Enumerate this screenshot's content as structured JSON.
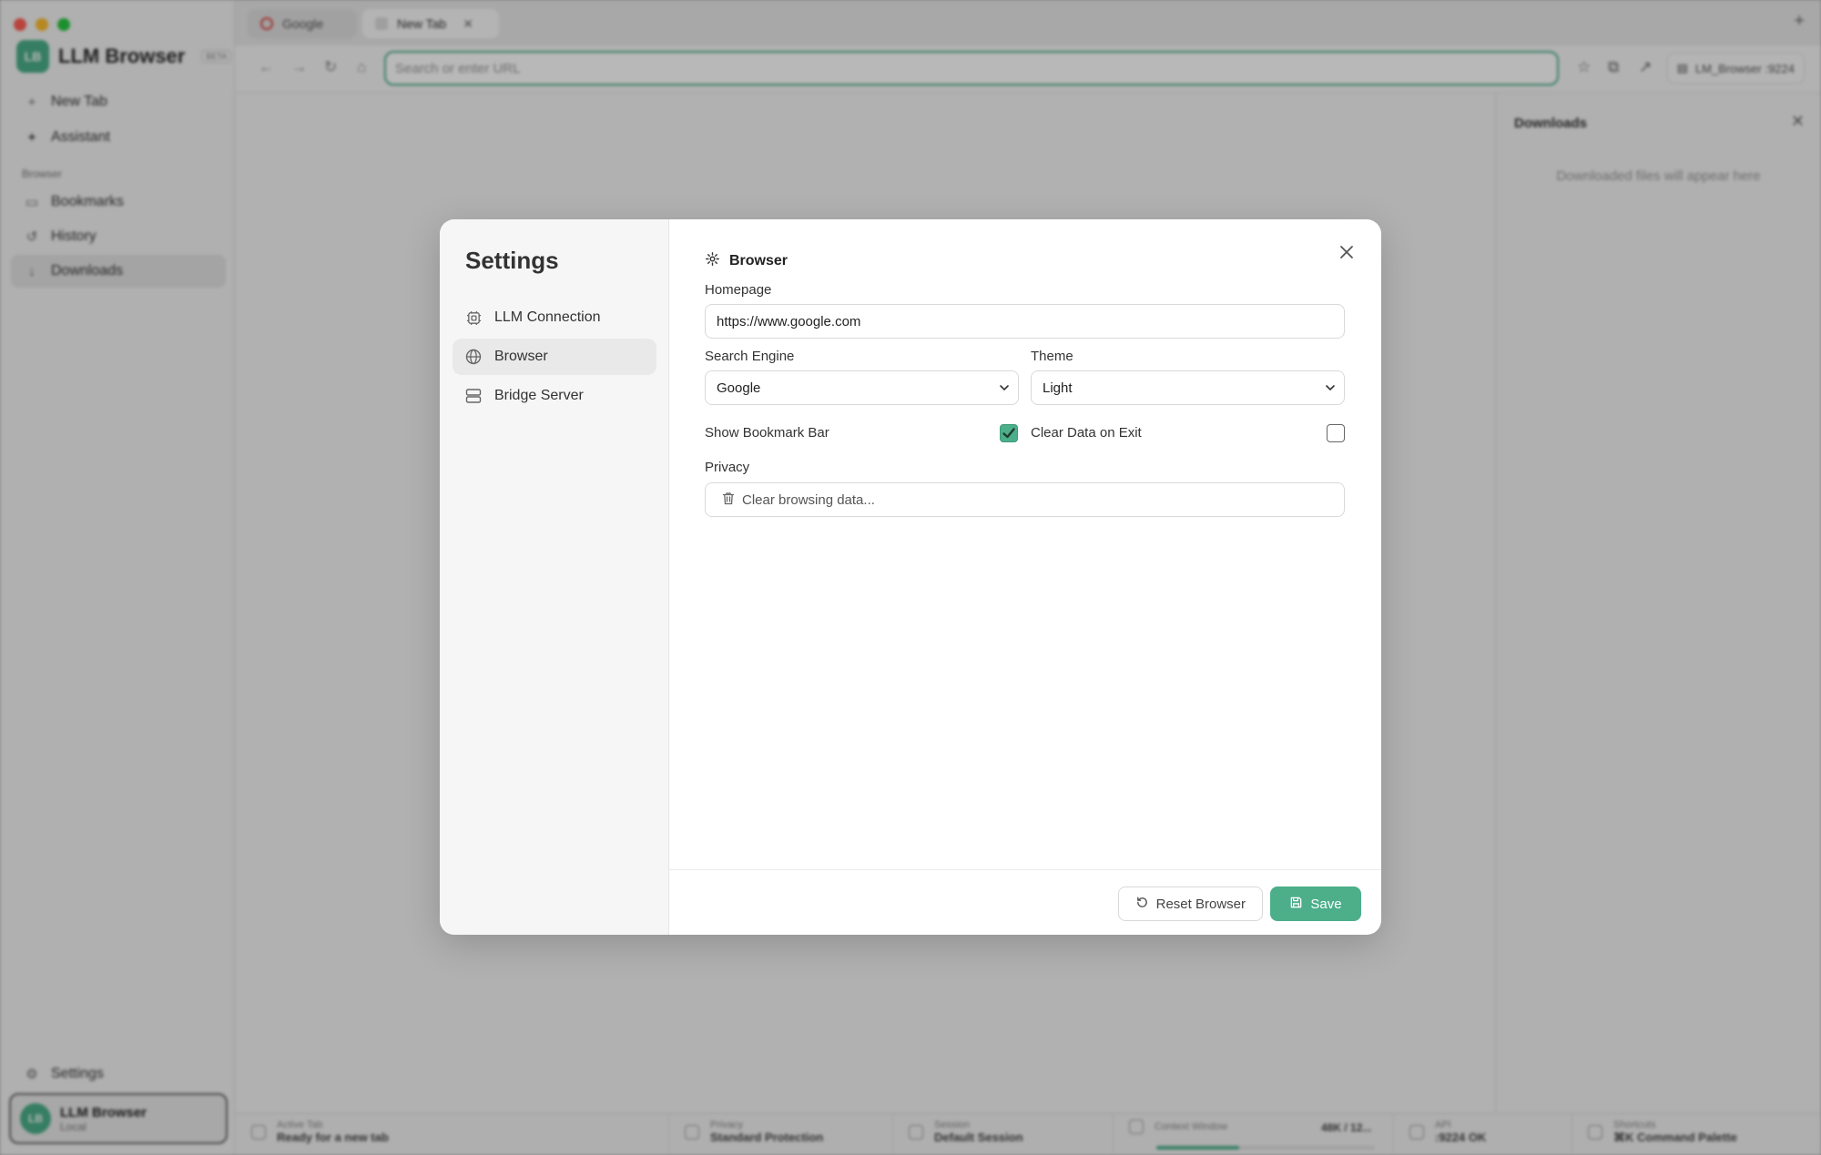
{
  "app": {
    "brand_name": "LLM Browser",
    "brand_logo_text": "LB",
    "beta_label": "BETA",
    "sidebar": {
      "items": [
        {
          "label": "New Tab",
          "icon": "plus-icon"
        },
        {
          "label": "Assistant",
          "icon": "sparkle-icon"
        }
      ],
      "group_label": "Browser",
      "group_items": [
        {
          "label": "Bookmarks",
          "icon": "book-icon"
        },
        {
          "label": "History",
          "icon": "history-icon"
        },
        {
          "label": "Downloads",
          "icon": "download-icon"
        }
      ],
      "settings_label": "Settings",
      "user": {
        "avatar": "LB",
        "name": "LLM Browser",
        "sub": "Local"
      }
    },
    "tabs": [
      {
        "title": "Google"
      },
      {
        "title": "New Tab"
      }
    ],
    "toolbar": {
      "url_placeholder": "Search or enter URL",
      "profile_label": "LM_Browser :9224"
    },
    "downloads_panel": {
      "title": "Downloads",
      "empty_text": "Downloaded files will appear here"
    },
    "status": {
      "active_tab": {
        "label": "Active Tab",
        "value": "Ready for a new tab"
      },
      "privacy": {
        "label": "Privacy",
        "value": "Standard Protection"
      },
      "session": {
        "label": "Session",
        "value": "Default Session"
      },
      "context_window": {
        "label": "Context Window",
        "value": "48K / 12...",
        "fill": 0.38
      },
      "api": {
        "label": "API",
        "value": ":9224 OK"
      },
      "shortcuts": {
        "label": "Shortcuts",
        "value": "⌘K Command Palette"
      }
    }
  },
  "settings": {
    "title": "Settings",
    "nav": [
      {
        "label": "LLM Connection",
        "icon": "chip-icon"
      },
      {
        "label": "Browser",
        "icon": "globe-icon"
      },
      {
        "label": "Bridge Server",
        "icon": "server-icon"
      }
    ],
    "section_title": "Browser",
    "homepage_label": "Homepage",
    "homepage_value": "https://www.google.com",
    "search_engine_label": "Search Engine",
    "search_engine_value": "Google",
    "theme_label": "Theme",
    "theme_value": "Light",
    "show_bookmark_bar_label": "Show Bookmark Bar",
    "show_bookmark_bar_checked": true,
    "clear_data_label": "Clear Data on Exit",
    "clear_data_checked": false,
    "privacy_label": "Privacy",
    "clear_browsing_label": "Clear browsing data...",
    "reset_label": "Reset Browser",
    "save_label": "Save",
    "accent_color": "#4caf8a"
  }
}
